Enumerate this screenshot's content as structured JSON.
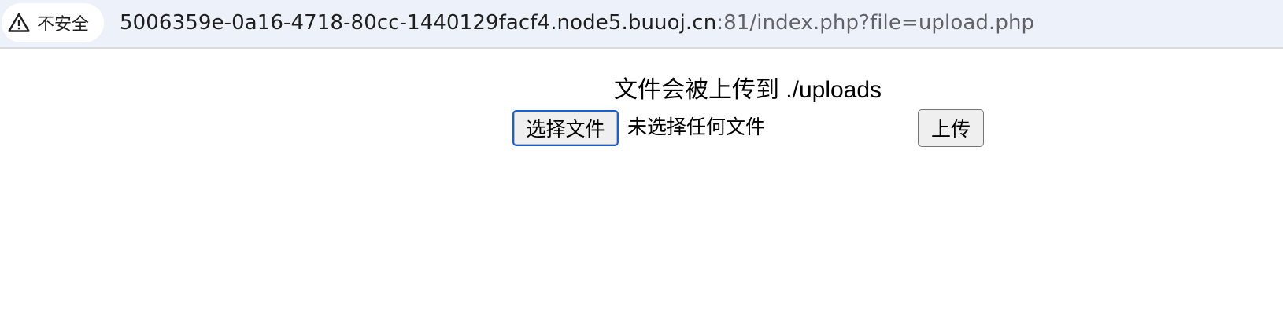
{
  "browser": {
    "security_label": "不安全",
    "security_icon": "warning-triangle-icon",
    "url_host": "5006359e-0a16-4718-80cc-1440129facf4.node5.buuoj.cn",
    "url_rest": ":81/index.php?file=upload.php"
  },
  "page": {
    "heading": "文件会被上传到 ./uploads",
    "choose_file_label": "选择文件",
    "file_status": "未选择任何文件",
    "upload_label": "上传"
  }
}
